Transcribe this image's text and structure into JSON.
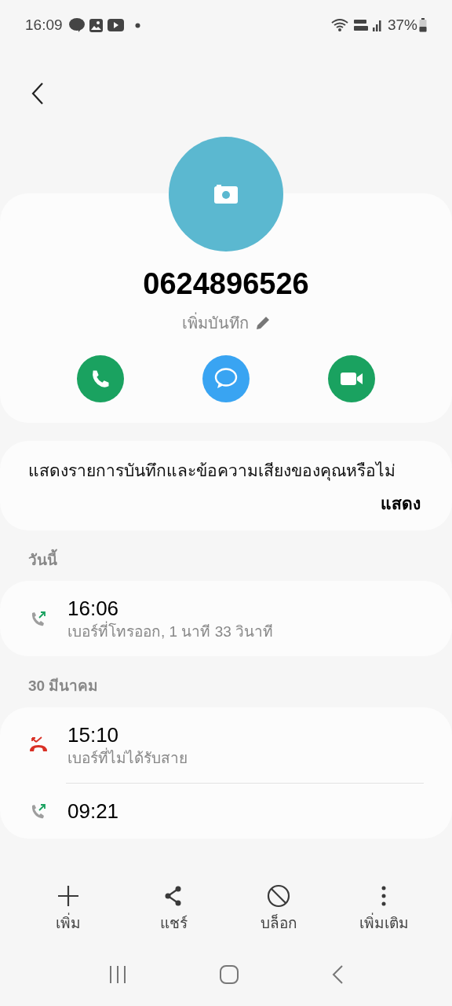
{
  "status_bar": {
    "time": "16:09",
    "battery": "37%"
  },
  "contact": {
    "number": "0624896526",
    "add_note": "เพิ่มบันทึก"
  },
  "banner": {
    "text": "แสดงรายการบันทึกและข้อความเสียงของคุณหรือไม่",
    "action": "แสดง"
  },
  "call_groups": [
    {
      "date": "วันนี้",
      "calls": [
        {
          "kind": "outgoing",
          "time": "16:06",
          "detail": "เบอร์ที่โทรออก, 1 นาที 33 วินาที"
        }
      ]
    },
    {
      "date": "30 มีนาคม",
      "calls": [
        {
          "kind": "missed",
          "time": "15:10",
          "detail": "เบอร์ที่ไม่ได้รับสาย"
        },
        {
          "kind": "outgoing",
          "time": "09:21"
        }
      ]
    }
  ],
  "bottom_actions": [
    {
      "kind": "add",
      "label": "เพิ่ม"
    },
    {
      "kind": "share",
      "label": "แชร์"
    },
    {
      "kind": "block",
      "label": "บล็อก"
    },
    {
      "kind": "more",
      "label": "เพิ่มเติม"
    }
  ]
}
